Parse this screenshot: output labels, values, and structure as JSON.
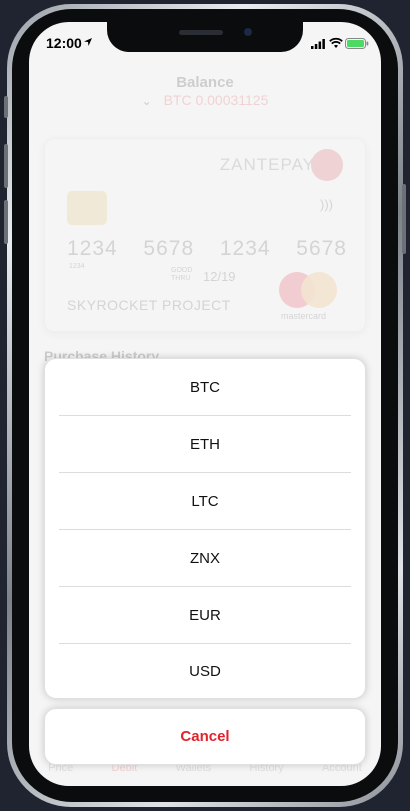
{
  "status_bar": {
    "time": "12:00",
    "icons": [
      "location-arrow-icon",
      "signal-icon",
      "wifi-icon",
      "battery-icon"
    ],
    "battery_color": "#4cd964"
  },
  "background": {
    "balance_title": "Balance",
    "balance_value": "BTC 0.00031125",
    "card": {
      "brand": "ZANTEPAY",
      "number_groups": [
        "1234",
        "5678",
        "1234",
        "5678"
      ],
      "number_small": "1234",
      "valid_label": "GOOD THRU",
      "expiry": "12/19",
      "holder": "SKYROCKET PROJECT",
      "network": "mastercard"
    },
    "history_title": "Purchase History",
    "tabs": [
      "Price",
      "Debit",
      "Wallets",
      "History",
      "Account"
    ],
    "active_tab": "Debit"
  },
  "action_sheet": {
    "options": [
      "BTC",
      "ETH",
      "LTC",
      "ZNX",
      "EUR",
      "USD"
    ],
    "cancel_label": "Cancel"
  },
  "colors": {
    "accent": "#e0242b",
    "phone_background": "#1f2430"
  }
}
